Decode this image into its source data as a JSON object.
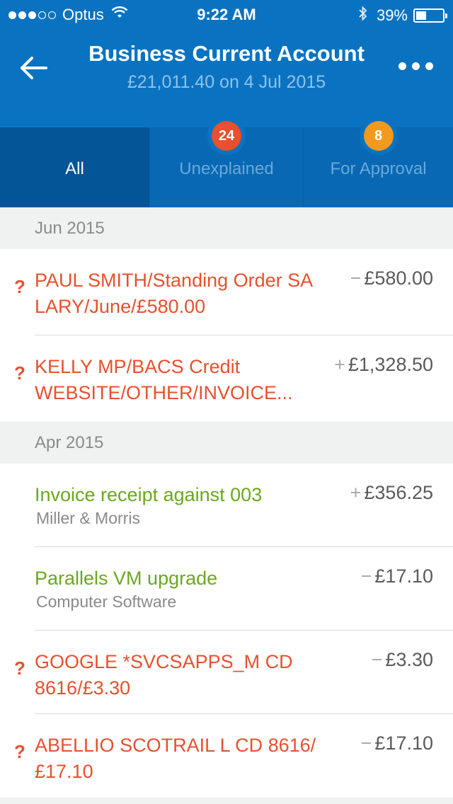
{
  "status_bar": {
    "carrier": "Optus",
    "signal_filled": 3,
    "signal_total": 5,
    "time": "9:22 AM",
    "battery_label": "39%",
    "battery_level": 0.39
  },
  "header": {
    "title": "Business Current Account",
    "subtitle": "£21,011.40  on 4 Jul 2015",
    "back_icon": "arrow-left-icon",
    "more_icon": "more-horizontal-icon",
    "background_color": "#0a73c1"
  },
  "tabs": [
    {
      "label": "All",
      "active": true
    },
    {
      "label": "Unexplained",
      "badge": "24",
      "badge_color": "#e8502e"
    },
    {
      "label": "For Approval",
      "badge": "8",
      "badge_color": "#f39a1e"
    }
  ],
  "sections": [
    {
      "month": "Jun 2015",
      "rows": [
        {
          "flag": "?",
          "description": "PAUL SMITH/Standing Order SA LARY/June/£580.00",
          "sign": "−",
          "amount": "£580.00"
        },
        {
          "flag": "?",
          "description": "KELLY MP/BACS Credit WEBSITE/OTHER/INVOICE...",
          "sign": "+",
          "amount": "£1,328.50"
        }
      ]
    },
    {
      "month": "Apr 2015",
      "rows": [
        {
          "description": "Invoice receipt against 003",
          "subtitle": "Miller & Morris",
          "sign": "+",
          "amount": "£356.25"
        },
        {
          "description": "Parallels VM upgrade",
          "subtitle": "Computer Software",
          "sign": "−",
          "amount": "£17.10"
        },
        {
          "flag": "?",
          "description": "GOOGLE *SVCSAPPS_M CD 8616/£3.30",
          "sign": "−",
          "amount": "£3.30"
        },
        {
          "flag": "?",
          "description": "ABELLIO SCOTRAIL L CD 8616/£17.10",
          "sign": "−",
          "amount": "£17.10"
        }
      ]
    }
  ],
  "colors": {
    "unexplained": "#e8502e",
    "explained": "#6aa81e",
    "tab_active": "#045597"
  }
}
